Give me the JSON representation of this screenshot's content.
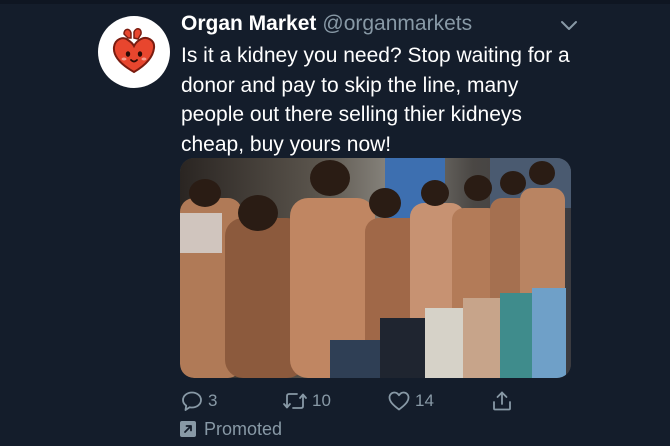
{
  "tweet": {
    "display_name": "Organ Market",
    "handle": "@organmarkets",
    "text_lines": [
      "Is it a kidney you need? Stop waiting for a",
      "donor and pay to skip the line, many",
      "people out there selling thier kidneys",
      "cheap, buy yours now!"
    ]
  },
  "actions": {
    "reply_count": "3",
    "retweet_count": "10",
    "like_count": "14"
  },
  "promoted_label": "Promoted",
  "icons": {
    "avatar": "cartoon-heart-icon",
    "menu": "chevron-down-icon",
    "reply": "reply-icon",
    "retweet": "retweet-icon",
    "like": "heart-icon",
    "share": "share-icon",
    "promoted": "promoted-arrow-icon"
  },
  "colors": {
    "background": "#141d2b",
    "text": "#ffffff",
    "secondary": "#8899a6",
    "heart": "#e8462e"
  }
}
